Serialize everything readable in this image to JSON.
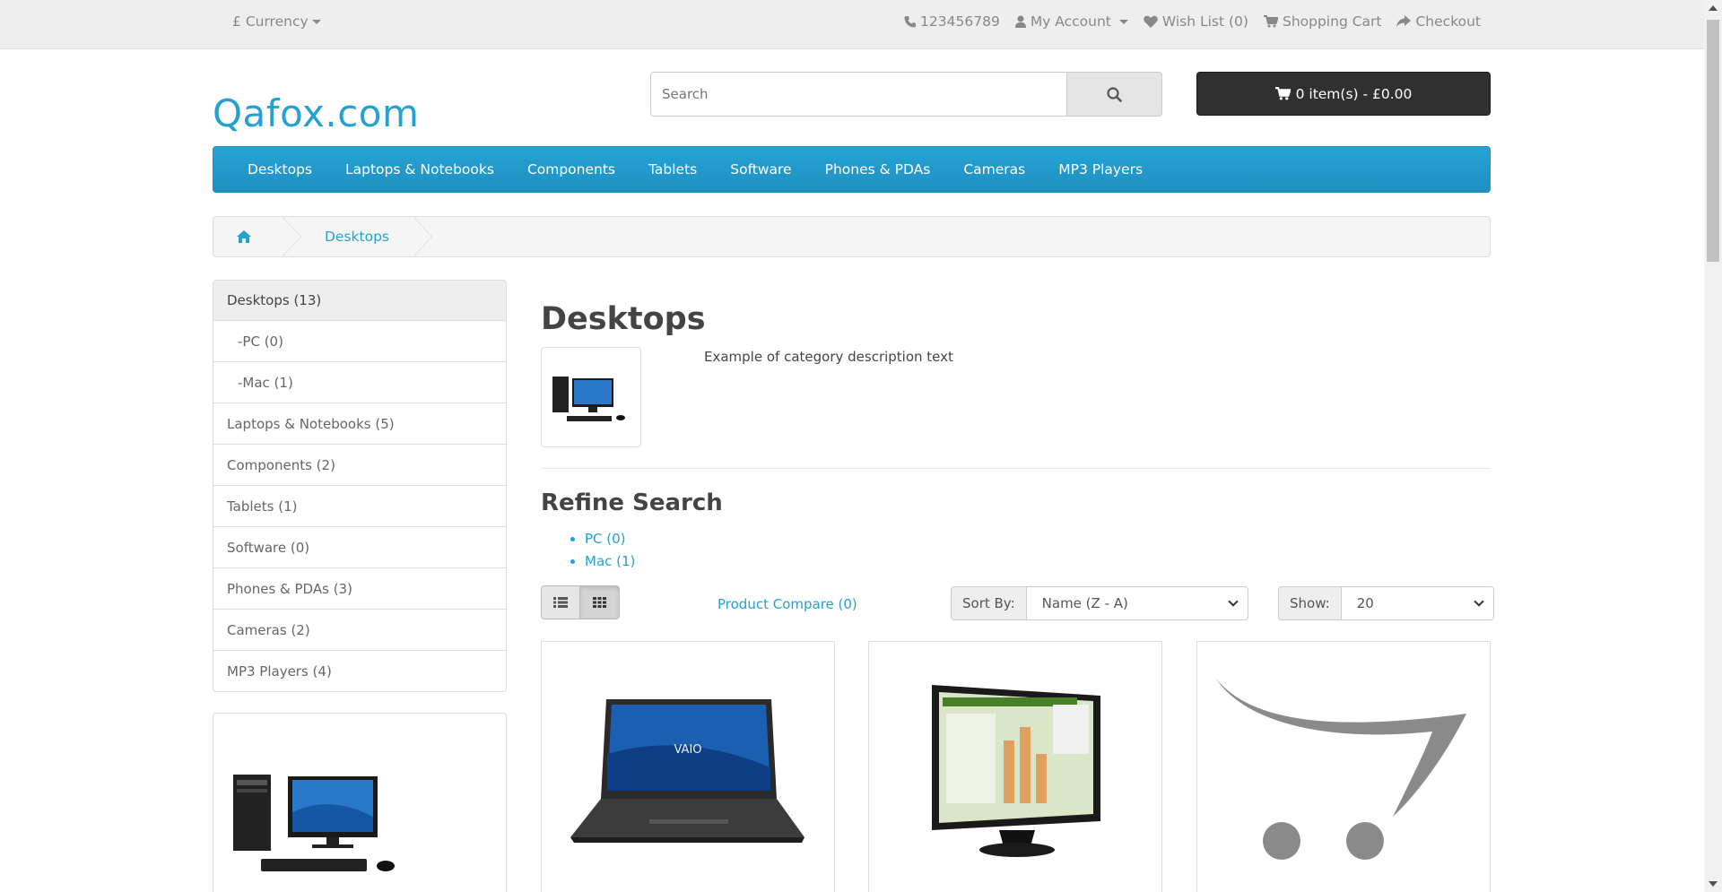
{
  "topbar": {
    "currency_symbol": "£",
    "currency_label": "Currency",
    "phone": "123456789",
    "my_account": "My Account",
    "wishlist": "Wish List (0)",
    "shopping_cart": "Shopping Cart",
    "checkout": "Checkout"
  },
  "header": {
    "logo": "Qafox.com",
    "search_placeholder": "Search",
    "cart_summary": "0 item(s) - £0.00"
  },
  "menu": [
    "Desktops",
    "Laptops & Notebooks",
    "Components",
    "Tablets",
    "Software",
    "Phones & PDAs",
    "Cameras",
    "MP3 Players"
  ],
  "breadcrumb": {
    "current": "Desktops"
  },
  "sidebar": [
    {
      "label": "Desktops (13)",
      "type": "active"
    },
    {
      "label": "-PC (0)",
      "type": "sub"
    },
    {
      "label": "-Mac (1)",
      "type": "sub"
    },
    {
      "label": "Laptops & Notebooks (5)",
      "type": "normal"
    },
    {
      "label": "Components (2)",
      "type": "normal"
    },
    {
      "label": "Tablets (1)",
      "type": "normal"
    },
    {
      "label": "Software (0)",
      "type": "normal"
    },
    {
      "label": "Phones & PDAs (3)",
      "type": "normal"
    },
    {
      "label": "Cameras (2)",
      "type": "normal"
    },
    {
      "label": "MP3 Players (4)",
      "type": "normal"
    }
  ],
  "content": {
    "title": "Desktops",
    "description": "Example of category description text",
    "refine_title": "Refine Search",
    "refine_items": [
      "PC (0)",
      "Mac (1)"
    ],
    "product_compare": "Product Compare (0)",
    "sort_label": "Sort By:",
    "sort_value": "Name (Z - A)",
    "show_label": "Show:",
    "show_value": "20"
  },
  "colors": {
    "link": "#23a1d1",
    "menu": "#229ac8",
    "cart_button": "#303030"
  }
}
